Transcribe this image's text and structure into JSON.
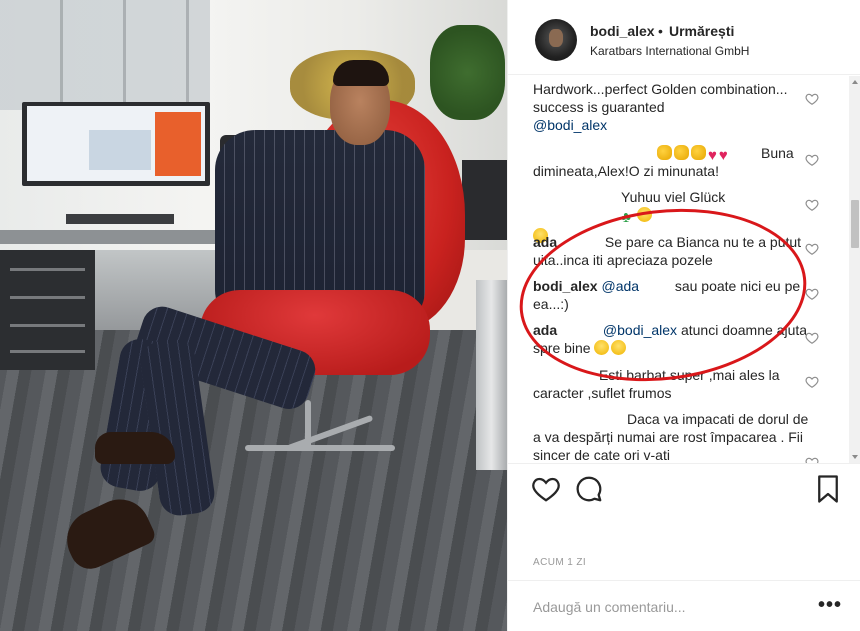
{
  "post": {
    "username": "bodi_alex",
    "separator": "•",
    "follow_label": "Urmărești",
    "location": "Karatbars International GmbH"
  },
  "comments": [
    {
      "author": "",
      "text": "Hardwork...perfect Golden combination... success is guaranted ",
      "mention": "@bodi_alex"
    },
    {
      "author": "",
      "text": "Buna dimineata,Alex!O zi minunata!",
      "emoji_names": [
        "clap-emoji",
        "clap-emoji",
        "clap-emoji",
        "heart-emoji",
        "heart-emoji"
      ]
    },
    {
      "author": "",
      "text": "Yuhuu viel Glück",
      "emoji_names": [
        "clover-emoji",
        "smile-emoji",
        "tongue-emoji"
      ]
    },
    {
      "author": "ada",
      "text": "Se pare ca Bianca nu te a putut uita..inca iti apreciaza pozele"
    },
    {
      "author": "bodi_alex",
      "mention": "@ada",
      "text": "sau poate nici eu pe ea...:)"
    },
    {
      "author": "ada",
      "mention": "@bodi_alex",
      "text": "atunci doamne ajuta spre bine",
      "emoji_names": [
        "smile-emoji",
        "smile-emoji"
      ]
    },
    {
      "author": "",
      "text": "Esti barbat super ,mai ales la caracter ,suflet frumos"
    },
    {
      "author": "",
      "text": "Daca va impacati de dorul de a va despărți numai are rost împacarea . Fii sincer de cate ori v-ati"
    }
  ],
  "time_label": "ACUM 1 ZI",
  "add_comment_placeholder": "Adaugă un comentariu...",
  "more_label": "•••",
  "colors": {
    "annotation_circle": "#d9171a",
    "mention": "#003569",
    "muted_text": "#999999"
  },
  "icons": [
    "heart-icon",
    "comment-icon",
    "bookmark-icon",
    "more-options-icon",
    "like-comment-icon"
  ]
}
